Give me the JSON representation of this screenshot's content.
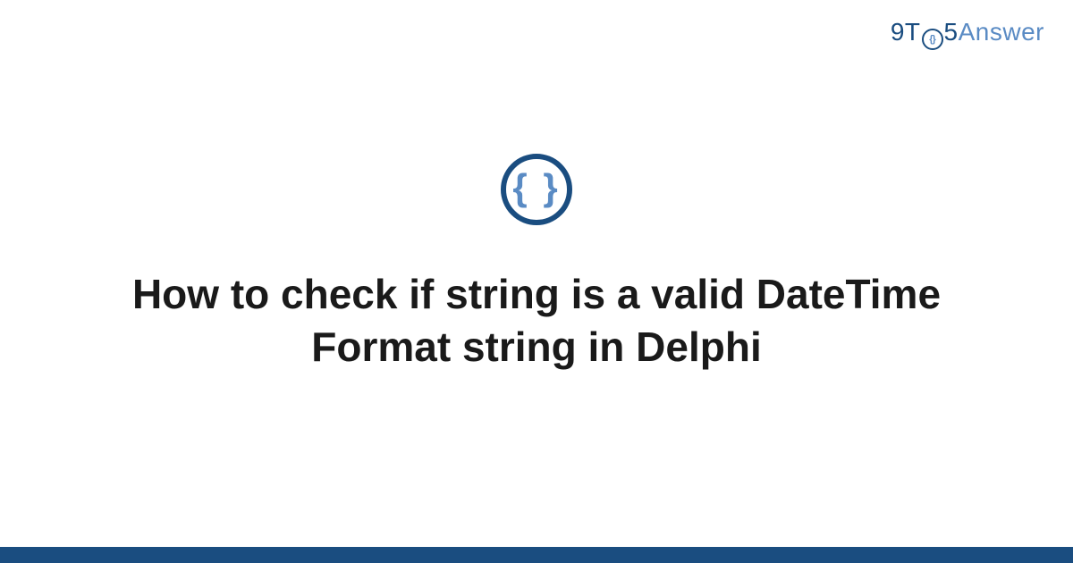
{
  "site": {
    "logo_part1": "9T",
    "logo_part2": "5",
    "logo_part3": "Answer",
    "logo_icon_inner": "{}"
  },
  "category": {
    "icon_braces": "{ }"
  },
  "question": {
    "title": "How to check if string is a valid DateTime Format string in Delphi"
  },
  "colors": {
    "primary_dark": "#1a4d80",
    "primary_light": "#5a8bc4"
  }
}
